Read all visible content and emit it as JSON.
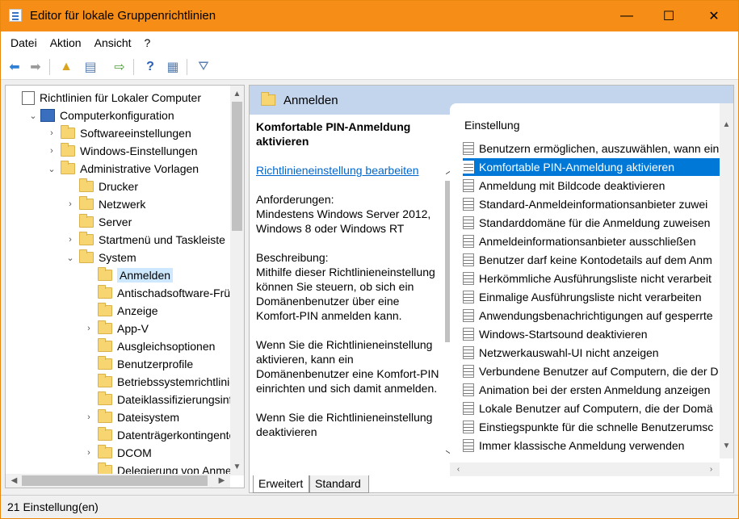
{
  "window": {
    "title": "Editor für lokale Gruppenrichtlinien",
    "min": "—",
    "max": "☐",
    "close": "✕"
  },
  "menu": [
    "Datei",
    "Aktion",
    "Ansicht",
    "?"
  ],
  "toolbar_icons": [
    "back-icon",
    "forward-icon",
    "up-folder-icon",
    "show-hide-tree-icon",
    "export-list-icon",
    "help-icon",
    "properties-icon",
    "filter-icon"
  ],
  "tree": {
    "items": [
      {
        "label": "Richtlinien für Lokaler Computer",
        "level": 0,
        "exp": "",
        "icon": "doc"
      },
      {
        "label": "Computerkonfiguration",
        "level": 1,
        "exp": "⌄",
        "icon": "pc"
      },
      {
        "label": "Softwareeinstellungen",
        "level": 2,
        "exp": "›",
        "icon": "folder"
      },
      {
        "label": "Windows-Einstellungen",
        "level": 2,
        "exp": "›",
        "icon": "folder"
      },
      {
        "label": "Administrative Vorlagen",
        "level": 2,
        "exp": "⌄",
        "icon": "folder"
      },
      {
        "label": "Drucker",
        "level": 3,
        "exp": "",
        "icon": "folder"
      },
      {
        "label": "Netzwerk",
        "level": 3,
        "exp": "›",
        "icon": "folder"
      },
      {
        "label": "Server",
        "level": 3,
        "exp": "",
        "icon": "folder"
      },
      {
        "label": "Startmenü und Taskleiste",
        "level": 3,
        "exp": "›",
        "icon": "folder"
      },
      {
        "label": "System",
        "level": 3,
        "exp": "⌄",
        "icon": "folder"
      },
      {
        "label": "Anmelden",
        "level": 4,
        "exp": "",
        "icon": "folder",
        "selected": true
      },
      {
        "label": "Antischadsoftware-Früh",
        "level": 4,
        "exp": "",
        "icon": "folder"
      },
      {
        "label": "Anzeige",
        "level": 4,
        "exp": "",
        "icon": "folder"
      },
      {
        "label": "App-V",
        "level": 4,
        "exp": "›",
        "icon": "folder"
      },
      {
        "label": "Ausgleichsoptionen",
        "level": 4,
        "exp": "",
        "icon": "folder"
      },
      {
        "label": "Benutzerprofile",
        "level": 4,
        "exp": "",
        "icon": "folder"
      },
      {
        "label": "Betriebssystemrichtlinie",
        "level": 4,
        "exp": "",
        "icon": "folder"
      },
      {
        "label": "Dateiklassifizierungsinfr",
        "level": 4,
        "exp": "",
        "icon": "folder"
      },
      {
        "label": "Dateisystem",
        "level": 4,
        "exp": "›",
        "icon": "folder"
      },
      {
        "label": "Datenträgerkontingente",
        "level": 4,
        "exp": "",
        "icon": "folder"
      },
      {
        "label": "DCOM",
        "level": 4,
        "exp": "›",
        "icon": "folder"
      },
      {
        "label": "Delegierung von Anmel",
        "level": 4,
        "exp": "",
        "icon": "folder"
      }
    ]
  },
  "right": {
    "header": "Anmelden",
    "desc": {
      "title": "Komfortable PIN-Anmeldung aktivieren",
      "link": "Richtlinieneinstellung bearbeiten",
      "req_label": "Anforderungen:",
      "req_text": "Mindestens Windows Server 2012, Windows 8 oder Windows RT",
      "desc_label": "Beschreibung:",
      "desc_text": "Mithilfe dieser Richtlinieneinstellung können Sie steuern, ob sich ein Domänenbenutzer über eine Komfort-PIN anmelden kann.",
      "p2": "Wenn Sie die Richtlinieneinstellung aktivieren, kann ein Domänenbenutzer eine Komfort-PIN einrichten und sich damit anmelden.",
      "p3": "Wenn Sie die Richtlinieneinstellung deaktivieren"
    },
    "list_header": "Einstellung",
    "items": [
      "Benutzern ermöglichen, auszuwählen, wann ein",
      "Komfortable PIN-Anmeldung aktivieren",
      "Anmeldung mit Bildcode deaktivieren",
      "Standard-Anmeldeinformationsanbieter zuwei",
      "Standarddomäne für die Anmeldung zuweisen",
      "Anmeldeinformationsanbieter ausschließen",
      "Benutzer darf keine Kontodetails auf dem Anm",
      "Herkömmliche Ausführungsliste nicht verarbeit",
      "Einmalige Ausführungsliste nicht verarbeiten",
      "Anwendungsbenachrichtigungen auf gesperrte",
      "Windows-Startsound deaktivieren",
      "Netzwerkauswahl-UI nicht anzeigen",
      "Verbundene Benutzer auf Computern, die der D",
      "Animation bei der ersten Anmeldung anzeigen",
      "Lokale Benutzer auf Computern, die der Domä",
      "Einstiegspunkte für die schnelle Benutzerumsc",
      "Immer klassische Anmeldung verwenden"
    ],
    "selected_index": 1
  },
  "tabs": [
    "Erweitert",
    "Standard"
  ],
  "status": "21 Einstellung(en)",
  "colors": {
    "titlebar": "#f68d17",
    "selection": "#0078d7",
    "header": "#c3d5ec"
  }
}
